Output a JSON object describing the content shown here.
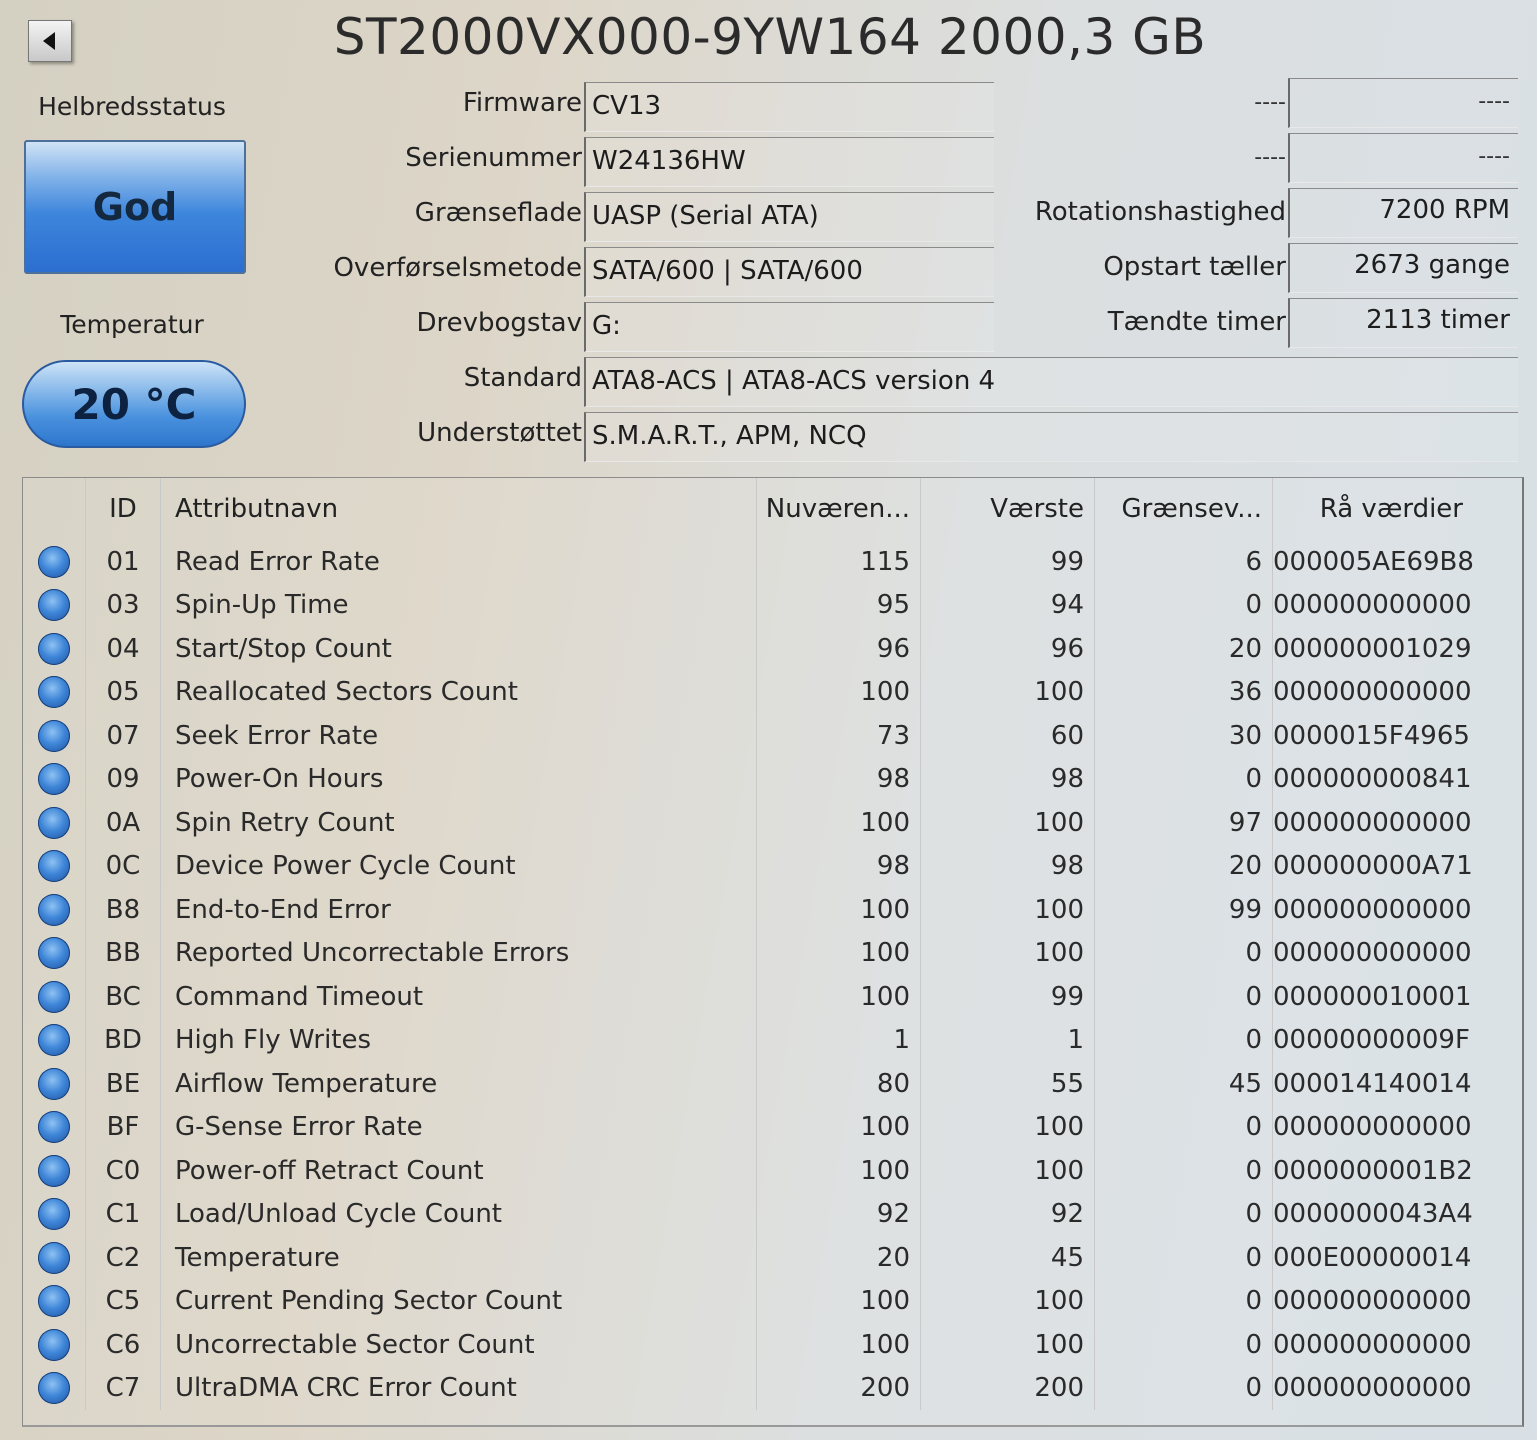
{
  "header": {
    "title": "ST2000VX000-9YW164 2000,3 GB",
    "back_icon": "triangle-left-icon"
  },
  "health": {
    "label": "Helbredsstatus",
    "value": "God"
  },
  "temperature": {
    "label": "Temperatur",
    "value": "20 °C"
  },
  "info": {
    "firmware": {
      "label": "Firmware",
      "value": "CV13"
    },
    "serial": {
      "label": "Serienummer",
      "value": "W24136HW"
    },
    "interface": {
      "label": "Grænseflade",
      "value": "UASP (Serial ATA)"
    },
    "transfer": {
      "label": "Overførselsmetode",
      "value": "SATA/600 | SATA/600"
    },
    "drive_letter": {
      "label": "Drevbogstav",
      "value": "G:"
    },
    "standard": {
      "label": "Standard",
      "value": "ATA8-ACS | ATA8-ACS version 4"
    },
    "supported": {
      "label": "Understøttet",
      "value": "S.M.A.R.T., APM, NCQ"
    }
  },
  "right_info": {
    "row1": {
      "label": "----",
      "value": "----"
    },
    "row2": {
      "label": "----",
      "value": "----"
    },
    "rotation": {
      "label": "Rotationshastighed",
      "value": "7200 RPM"
    },
    "power_on_count": {
      "label": "Opstart tæller",
      "value": "2673 gange"
    },
    "power_on_hours": {
      "label": "Tændte timer",
      "value": "2113 timer"
    }
  },
  "table": {
    "headers": [
      "ID",
      "Attributnavn",
      "Nuværen...",
      "Værste",
      "Grænsev...",
      "Rå værdier"
    ],
    "rows": [
      [
        "01",
        "Read Error Rate",
        "115",
        "99",
        "6",
        "000005AE69B8"
      ],
      [
        "03",
        "Spin-Up Time",
        "95",
        "94",
        "0",
        "000000000000"
      ],
      [
        "04",
        "Start/Stop Count",
        "96",
        "96",
        "20",
        "000000001029"
      ],
      [
        "05",
        "Reallocated Sectors Count",
        "100",
        "100",
        "36",
        "000000000000"
      ],
      [
        "07",
        "Seek Error Rate",
        "73",
        "60",
        "30",
        "0000015F4965"
      ],
      [
        "09",
        "Power-On Hours",
        "98",
        "98",
        "0",
        "000000000841"
      ],
      [
        "0A",
        "Spin Retry Count",
        "100",
        "100",
        "97",
        "000000000000"
      ],
      [
        "0C",
        "Device Power Cycle Count",
        "98",
        "98",
        "20",
        "000000000A71"
      ],
      [
        "B8",
        "End-to-End Error",
        "100",
        "100",
        "99",
        "000000000000"
      ],
      [
        "BB",
        "Reported Uncorrectable Errors",
        "100",
        "100",
        "0",
        "000000000000"
      ],
      [
        "BC",
        "Command Timeout",
        "100",
        "99",
        "0",
        "000000010001"
      ],
      [
        "BD",
        "High Fly Writes",
        "1",
        "1",
        "0",
        "00000000009F"
      ],
      [
        "BE",
        "Airflow Temperature",
        "80",
        "55",
        "45",
        "000014140014"
      ],
      [
        "BF",
        "G-Sense Error Rate",
        "100",
        "100",
        "0",
        "000000000000"
      ],
      [
        "C0",
        "Power-off Retract Count",
        "100",
        "100",
        "0",
        "0000000001B2"
      ],
      [
        "C1",
        "Load/Unload Cycle Count",
        "92",
        "92",
        "0",
        "0000000043A4"
      ],
      [
        "C2",
        "Temperature",
        "20",
        "45",
        "0",
        "000E00000014"
      ],
      [
        "C5",
        "Current Pending Sector Count",
        "100",
        "100",
        "0",
        "000000000000"
      ],
      [
        "C6",
        "Uncorrectable Sector Count",
        "100",
        "100",
        "0",
        "000000000000"
      ],
      [
        "C7",
        "UltraDMA CRC Error Count",
        "200",
        "200",
        "0",
        "000000000000"
      ]
    ]
  },
  "colors": {
    "status_good": "#3d86dc",
    "dot_blue": "#3f86d8"
  }
}
